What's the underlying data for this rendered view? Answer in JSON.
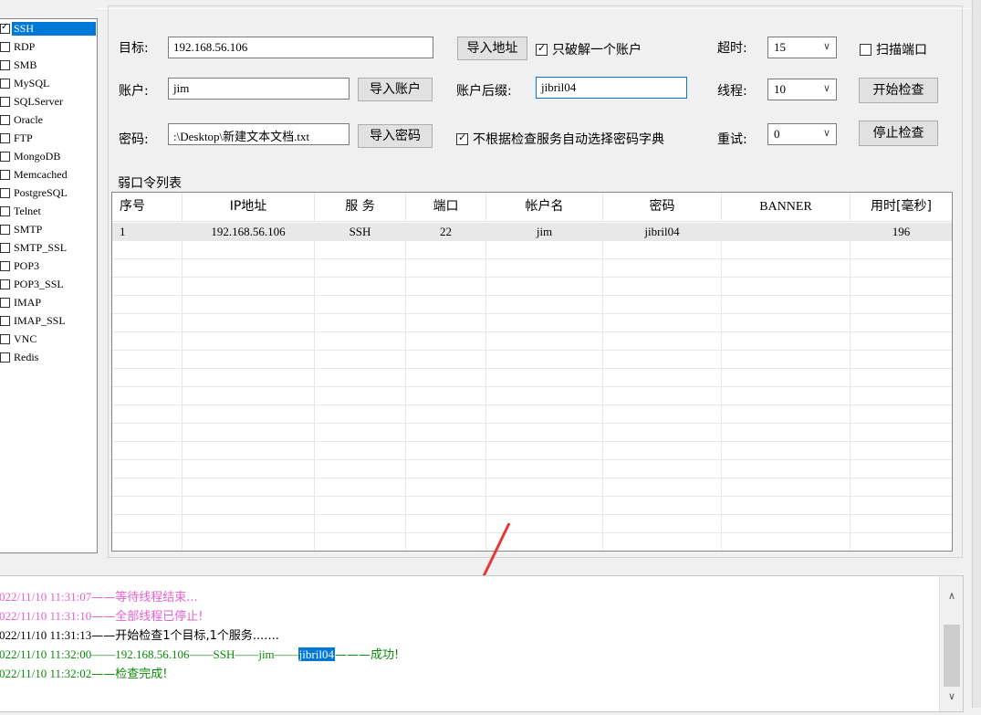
{
  "services": [
    {
      "name": "SSH",
      "checked": true,
      "selected": true
    },
    {
      "name": "RDP",
      "checked": false
    },
    {
      "name": "SMB",
      "checked": false
    },
    {
      "name": "MySQL",
      "checked": false
    },
    {
      "name": "SQLServer",
      "checked": false
    },
    {
      "name": "Oracle",
      "checked": false
    },
    {
      "name": "FTP",
      "checked": false
    },
    {
      "name": "MongoDB",
      "checked": false
    },
    {
      "name": "Memcached",
      "checked": false
    },
    {
      "name": "PostgreSQL",
      "checked": false
    },
    {
      "name": "Telnet",
      "checked": false
    },
    {
      "name": "SMTP",
      "checked": false
    },
    {
      "name": "SMTP_SSL",
      "checked": false
    },
    {
      "name": "POP3",
      "checked": false
    },
    {
      "name": "POP3_SSL",
      "checked": false
    },
    {
      "name": "IMAP",
      "checked": false
    },
    {
      "name": "IMAP_SSL",
      "checked": false
    },
    {
      "name": "VNC",
      "checked": false
    },
    {
      "name": "Redis",
      "checked": false
    }
  ],
  "form": {
    "target_label": "目标:",
    "target_value": "192.168.56.106",
    "import_address_btn": "导入地址",
    "only_crack_one_label": "只破解一个账户",
    "only_crack_one_checked": true,
    "timeout_label": "超时:",
    "timeout_value": "15",
    "scan_port_label": "扫描端口",
    "scan_port_checked": false,
    "account_label": "账户:",
    "account_value": "jim",
    "import_account_btn": "导入账户",
    "account_suffix_label": "账户后缀:",
    "account_suffix_value": "jibril04",
    "threads_label": "线程:",
    "threads_value": "10",
    "start_check_btn": "开始检查",
    "password_label": "密码:",
    "password_value": ":\\Desktop\\新建文本文档.txt",
    "import_password_btn": "导入密码",
    "auto_dict_label": "不根据检查服务自动选择密码字典",
    "auto_dict_checked": true,
    "retry_label": "重试:",
    "retry_value": "0",
    "stop_check_btn": "停止检查"
  },
  "table": {
    "title": "弱口令列表",
    "headers": [
      "序号",
      "IP地址",
      "服 务",
      "端口",
      "帐户名",
      "密码",
      "BANNER",
      "用时[毫秒]"
    ],
    "rows": [
      [
        "1",
        "192.168.56.106",
        "SSH",
        "22",
        "jim",
        "jibril04",
        "",
        "196"
      ]
    ]
  },
  "log": [
    {
      "time": "022/11/10 11:31:07",
      "text": "——等待线程结束...",
      "color": "#e85fd3"
    },
    {
      "time": "022/11/10 11:31:10",
      "text": "——全部线程已停止!",
      "color": "#e85fd3"
    },
    {
      "time": "022/11/10 11:31:13",
      "text": "——开始检查1个目标,1个服务.......",
      "color": "#000000"
    },
    {
      "time": "022/11/10 11:32:00",
      "pre": "——192.168.56.106——SSH——jim——",
      "highlight": "jibril04",
      "post": "———成功!",
      "color": "#0a8a0a"
    },
    {
      "time": "022/11/10 11:32:02",
      "text": "——检查完成!",
      "color": "#0a8a0a"
    }
  ],
  "colors": {
    "selection": "#0078d7",
    "arrow": "#e53935"
  }
}
